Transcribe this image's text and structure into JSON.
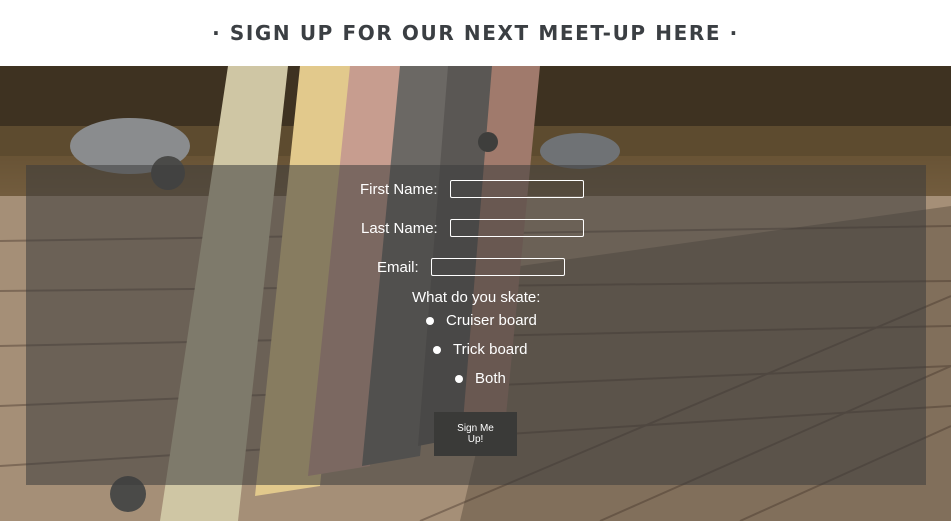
{
  "header": {
    "title": "· SIGN UP FOR OUR NEXT MEET-UP HERE ·"
  },
  "form": {
    "first_name_label": "First Name:",
    "first_name_value": "",
    "last_name_label": "Last Name:",
    "last_name_value": "",
    "email_label": "Email:",
    "email_value": "",
    "skate_question": "What do you skate:",
    "options": [
      {
        "label": "Cruiser board"
      },
      {
        "label": "Trick board"
      },
      {
        "label": "Both"
      }
    ],
    "submit_label": "Sign Me Up!"
  },
  "colors": {
    "header_text": "#3b3f43",
    "panel": "rgba(60,60,60,0.55)",
    "button": "#3a3a38"
  }
}
